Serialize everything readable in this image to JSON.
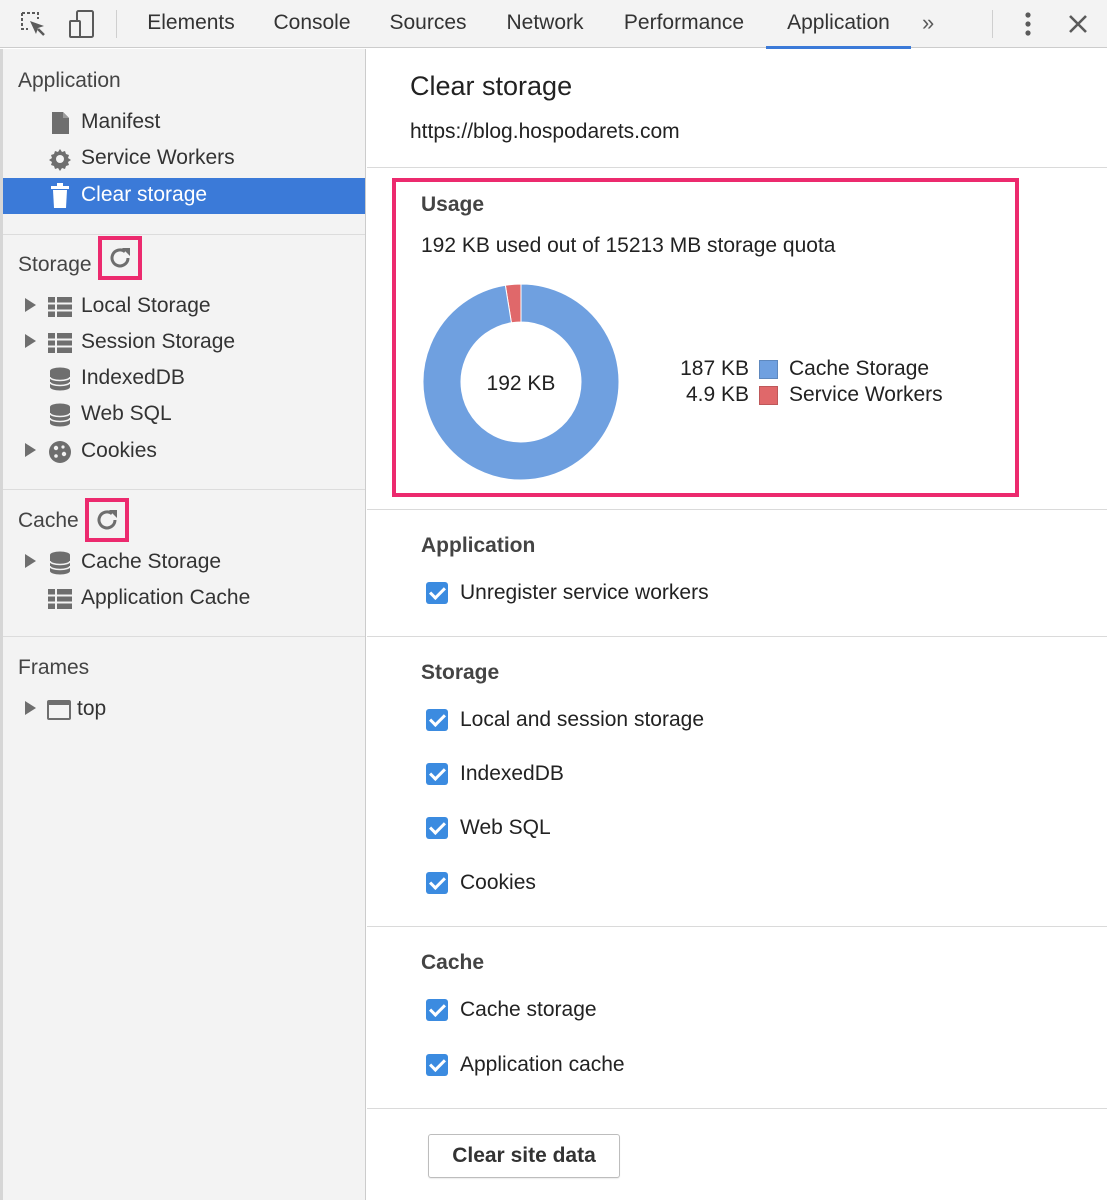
{
  "toolbar": {
    "tabs": [
      {
        "label": "Elements"
      },
      {
        "label": "Console"
      },
      {
        "label": "Sources"
      },
      {
        "label": "Network"
      },
      {
        "label": "Performance"
      },
      {
        "label": "Application",
        "active": true
      }
    ],
    "more_label": "»",
    "icons": [
      "inspect-element-icon",
      "device-toolbar-icon",
      "more-tabs-icon",
      "kebab-menu-icon",
      "close-icon"
    ],
    "active_tab_color": "#3b7ad8"
  },
  "sidebar": {
    "application": {
      "title": "Application",
      "items": [
        {
          "label": "Manifest",
          "icon": "document-icon"
        },
        {
          "label": "Service Workers",
          "icon": "gear-icon"
        },
        {
          "label": "Clear storage",
          "icon": "trash-icon",
          "selected": true
        }
      ]
    },
    "storage": {
      "title": "Storage",
      "items": [
        {
          "label": "Local Storage",
          "icon": "table-icon",
          "expandable": true
        },
        {
          "label": "Session Storage",
          "icon": "table-icon",
          "expandable": true
        },
        {
          "label": "IndexedDB",
          "icon": "database-icon"
        },
        {
          "label": "Web SQL",
          "icon": "database-icon"
        },
        {
          "label": "Cookies",
          "icon": "cookie-icon",
          "expandable": true
        }
      ]
    },
    "cache": {
      "title": "Cache",
      "items": [
        {
          "label": "Cache Storage",
          "icon": "database-icon",
          "expandable": true
        },
        {
          "label": "Application Cache",
          "icon": "table-icon"
        }
      ]
    },
    "frames": {
      "title": "Frames",
      "items": [
        {
          "label": "top",
          "icon": "frame-icon",
          "expandable": true
        }
      ]
    },
    "selected_color": "#3b7ad8",
    "highlight_color": "#ec2a6e"
  },
  "main": {
    "title": "Clear storage",
    "url": "https://blog.hospodarets.com",
    "usage": {
      "title": "Usage",
      "summary": "192 KB used out of 15213 MB storage quota",
      "center_label": "192 KB",
      "legend": [
        {
          "value": "187 KB",
          "label": "Cache Storage",
          "color": "#6fa0e0"
        },
        {
          "value": "4.9 KB",
          "label": "Service Workers",
          "color": "#e0686a"
        }
      ]
    },
    "application": {
      "title": "Application",
      "options": [
        {
          "label": "Unregister service workers",
          "checked": true
        }
      ]
    },
    "storage": {
      "title": "Storage",
      "options": [
        {
          "label": "Local and session storage",
          "checked": true
        },
        {
          "label": "IndexedDB",
          "checked": true
        },
        {
          "label": "Web SQL",
          "checked": true
        },
        {
          "label": "Cookies",
          "checked": true
        }
      ]
    },
    "cache": {
      "title": "Cache",
      "options": [
        {
          "label": "Cache storage",
          "checked": true
        },
        {
          "label": "Application cache",
          "checked": true
        }
      ]
    },
    "clear_button": "Clear site data"
  },
  "chart_data": {
    "type": "pie",
    "categories": [
      "Cache Storage",
      "Service Workers"
    ],
    "values": [
      187,
      4.9
    ],
    "title": "",
    "center_label": "192 KB",
    "legend_position": "right"
  }
}
